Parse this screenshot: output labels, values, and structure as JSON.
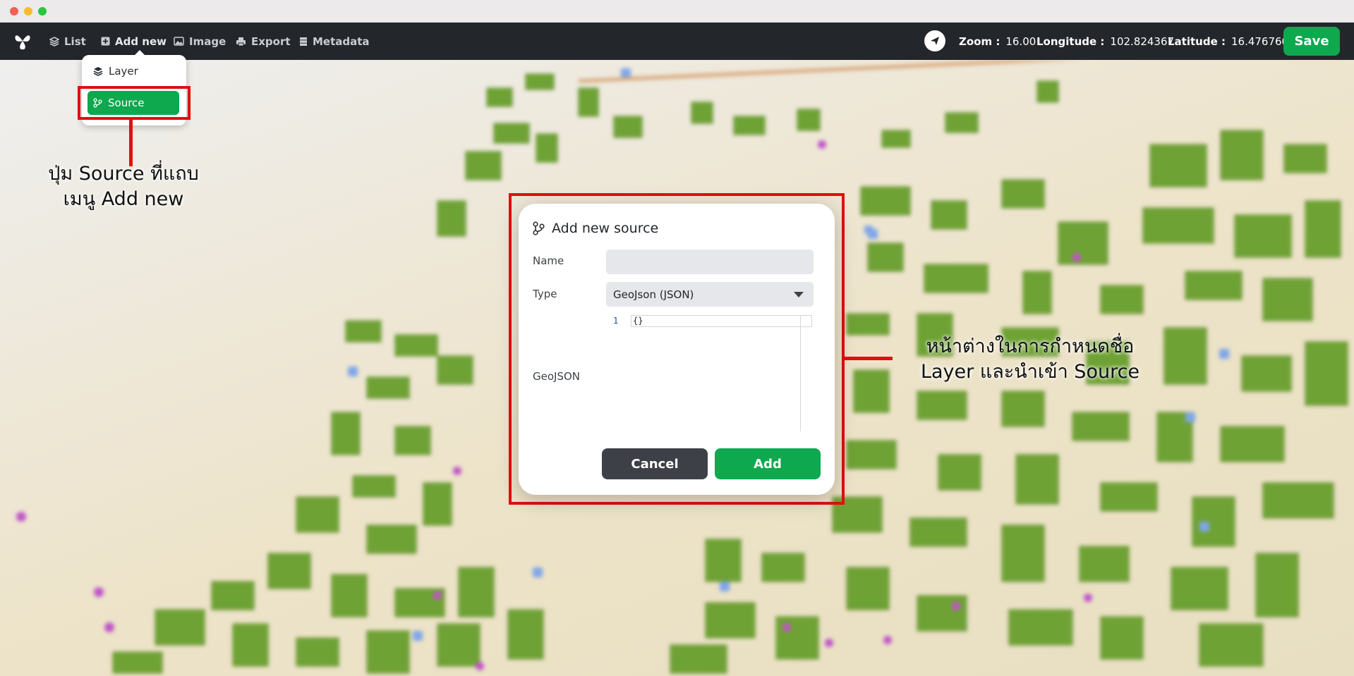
{
  "navbar": {
    "items": [
      "List",
      "Add new",
      "Image",
      "Export",
      "Metadata"
    ],
    "zoom_label": "Zoom :",
    "zoom_value": "16.00",
    "longitude_label": "Longitude :",
    "longitude_value": "102.824367",
    "latitude_label": "Latitude :",
    "latitude_value": "16.476760",
    "save_label": "Save"
  },
  "add_new_menu": {
    "items": [
      "Layer",
      "Source"
    ],
    "selected": "Source"
  },
  "dialog": {
    "title": "Add new source",
    "name_label": "Name",
    "name_value": "",
    "type_label": "Type",
    "type_value": "GeoJson (JSON)",
    "geojson_label": "GeoJSON",
    "editor_line_number": "1",
    "editor_text": "{}",
    "cancel_label": "Cancel",
    "add_label": "Add"
  },
  "annotations": {
    "source_button_note_line1": "ปุ่ม Source ที่แถบ",
    "source_button_note_line2": "เมนู Add new",
    "dialog_note_line1": "หน้าต่างในการกำหนดชื่อ",
    "dialog_note_line2": "Layer และนำเข้า Source"
  },
  "colors": {
    "accent_green": "#0ea84e",
    "navbar_bg": "#23262b",
    "annotation_red": "#e01010",
    "building_green": "#76a83a"
  }
}
